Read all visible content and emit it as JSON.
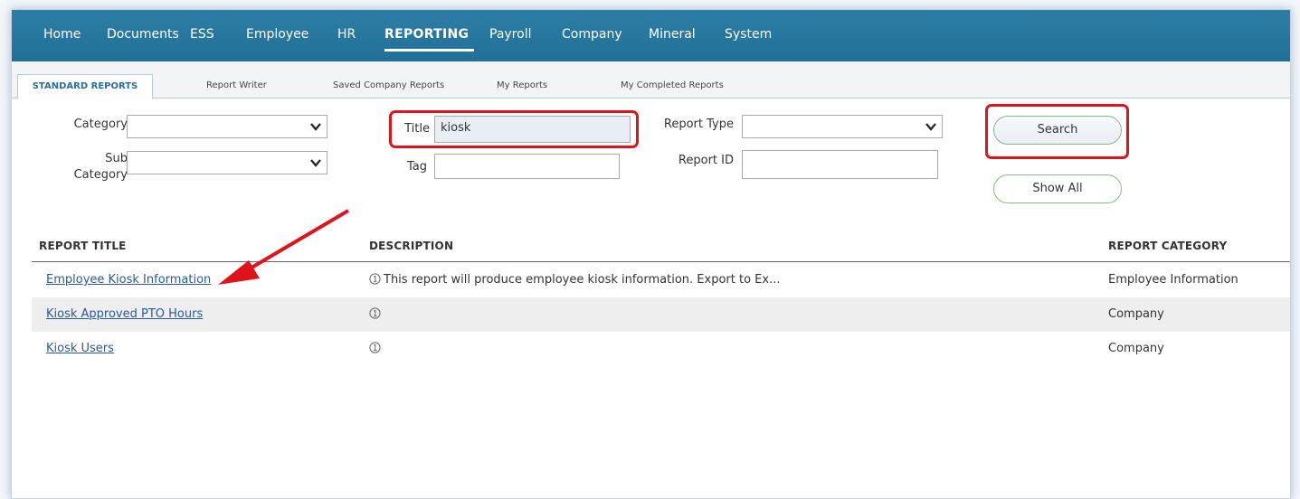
{
  "nav": {
    "items": [
      "Home",
      "Documents",
      "ESS",
      "Employee",
      "HR",
      "REPORTING",
      "Payroll",
      "Company",
      "Mineral",
      "System"
    ],
    "active": "REPORTING"
  },
  "tabs": [
    "STANDARD REPORTS",
    "Report Writer",
    "Saved Company Reports",
    "My Reports",
    "My Completed Reports"
  ],
  "filters": {
    "category_label": "Category",
    "subcategory_label_1": "Sub",
    "subcategory_label_2": "Category",
    "title_label": "Title",
    "title_value": "kiosk",
    "tag_label": "Tag",
    "tag_value": "",
    "report_type_label": "Report Type",
    "report_id_label": "Report ID",
    "report_id_value": "",
    "search_button": "Search",
    "show_all_button": "Show All"
  },
  "table": {
    "headers": {
      "title": "REPORT TITLE",
      "description": "DESCRIPTION",
      "category": "REPORT CATEGORY"
    },
    "rows": [
      {
        "title": "Employee Kiosk Information",
        "description": "This report will produce employee kiosk information. Export to Ex...",
        "category": "Employee Information"
      },
      {
        "title": "Kiosk Approved PTO Hours",
        "description": "",
        "category": "Company"
      },
      {
        "title": "Kiosk Users",
        "description": "",
        "category": "Company"
      }
    ]
  },
  "colors": {
    "nav_bg": "#2a78a0",
    "highlight": "#e0131d",
    "link": "#2a5a99",
    "active_tab": "#2a6f9a"
  }
}
